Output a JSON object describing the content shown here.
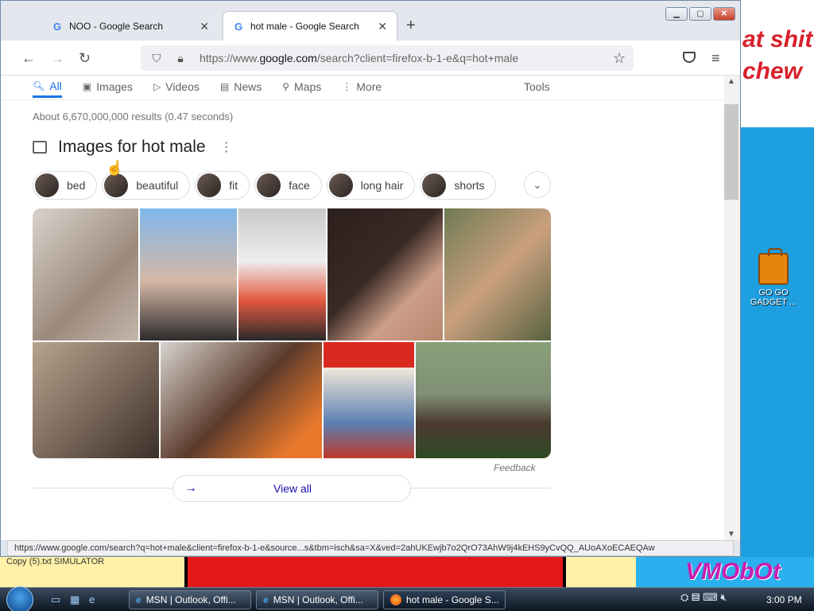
{
  "browser": {
    "tabs": [
      {
        "label": "NOO - Google Search",
        "active": false
      },
      {
        "label": "hot male - Google Search",
        "active": true
      }
    ],
    "new_tab": "+",
    "url_prefix": "https://www.",
    "url_domain": "google.com",
    "url_rest": "/search?client=firefox-b-1-e&q=hot+male",
    "status_url": "https://www.google.com/search?q=hot+male&client=firefox-b-1-e&source...s&tbm=isch&sa=X&ved=2ahUKEwjb7o2QrO73AhW9j4kEHS9yCvQQ_AUoAXoECAEQAw"
  },
  "search": {
    "tabs": [
      {
        "label": "All",
        "icon": "search-icon"
      },
      {
        "label": "Images",
        "icon": "image-icon"
      },
      {
        "label": "Videos",
        "icon": "play-icon"
      },
      {
        "label": "News",
        "icon": "news-icon"
      },
      {
        "label": "Maps",
        "icon": "map-pin-icon"
      },
      {
        "label": "More",
        "icon": "more-dots-icon"
      }
    ],
    "tools_label": "Tools",
    "result_stats": "About 6,670,000,000 results (0.47 seconds)"
  },
  "images": {
    "title": "Images for hot male",
    "chips": [
      "bed",
      "beautiful",
      "fit",
      "face",
      "long hair",
      "shorts"
    ],
    "feedback": "Feedback",
    "view_all": "View all"
  },
  "desktop": {
    "wall_text": "at shit\nchew",
    "icon_label": "GO GO\nGADGET ...",
    "corner_text": "Copy (5).txt     SIMULATOR",
    "watermark": "VMObOt"
  },
  "taskbar": {
    "items": [
      {
        "label": "MSN | Outlook, Offi...",
        "icon": "ie-icon"
      },
      {
        "label": "MSN | Outlook, Offi...",
        "icon": "ie-icon"
      },
      {
        "label": "hot male - Google S...",
        "icon": "firefox-icon"
      }
    ],
    "clock": "3:00 PM"
  },
  "colors": {
    "accent": "#1a73e8",
    "link": "#1a0dab",
    "close": "#c9412a"
  }
}
